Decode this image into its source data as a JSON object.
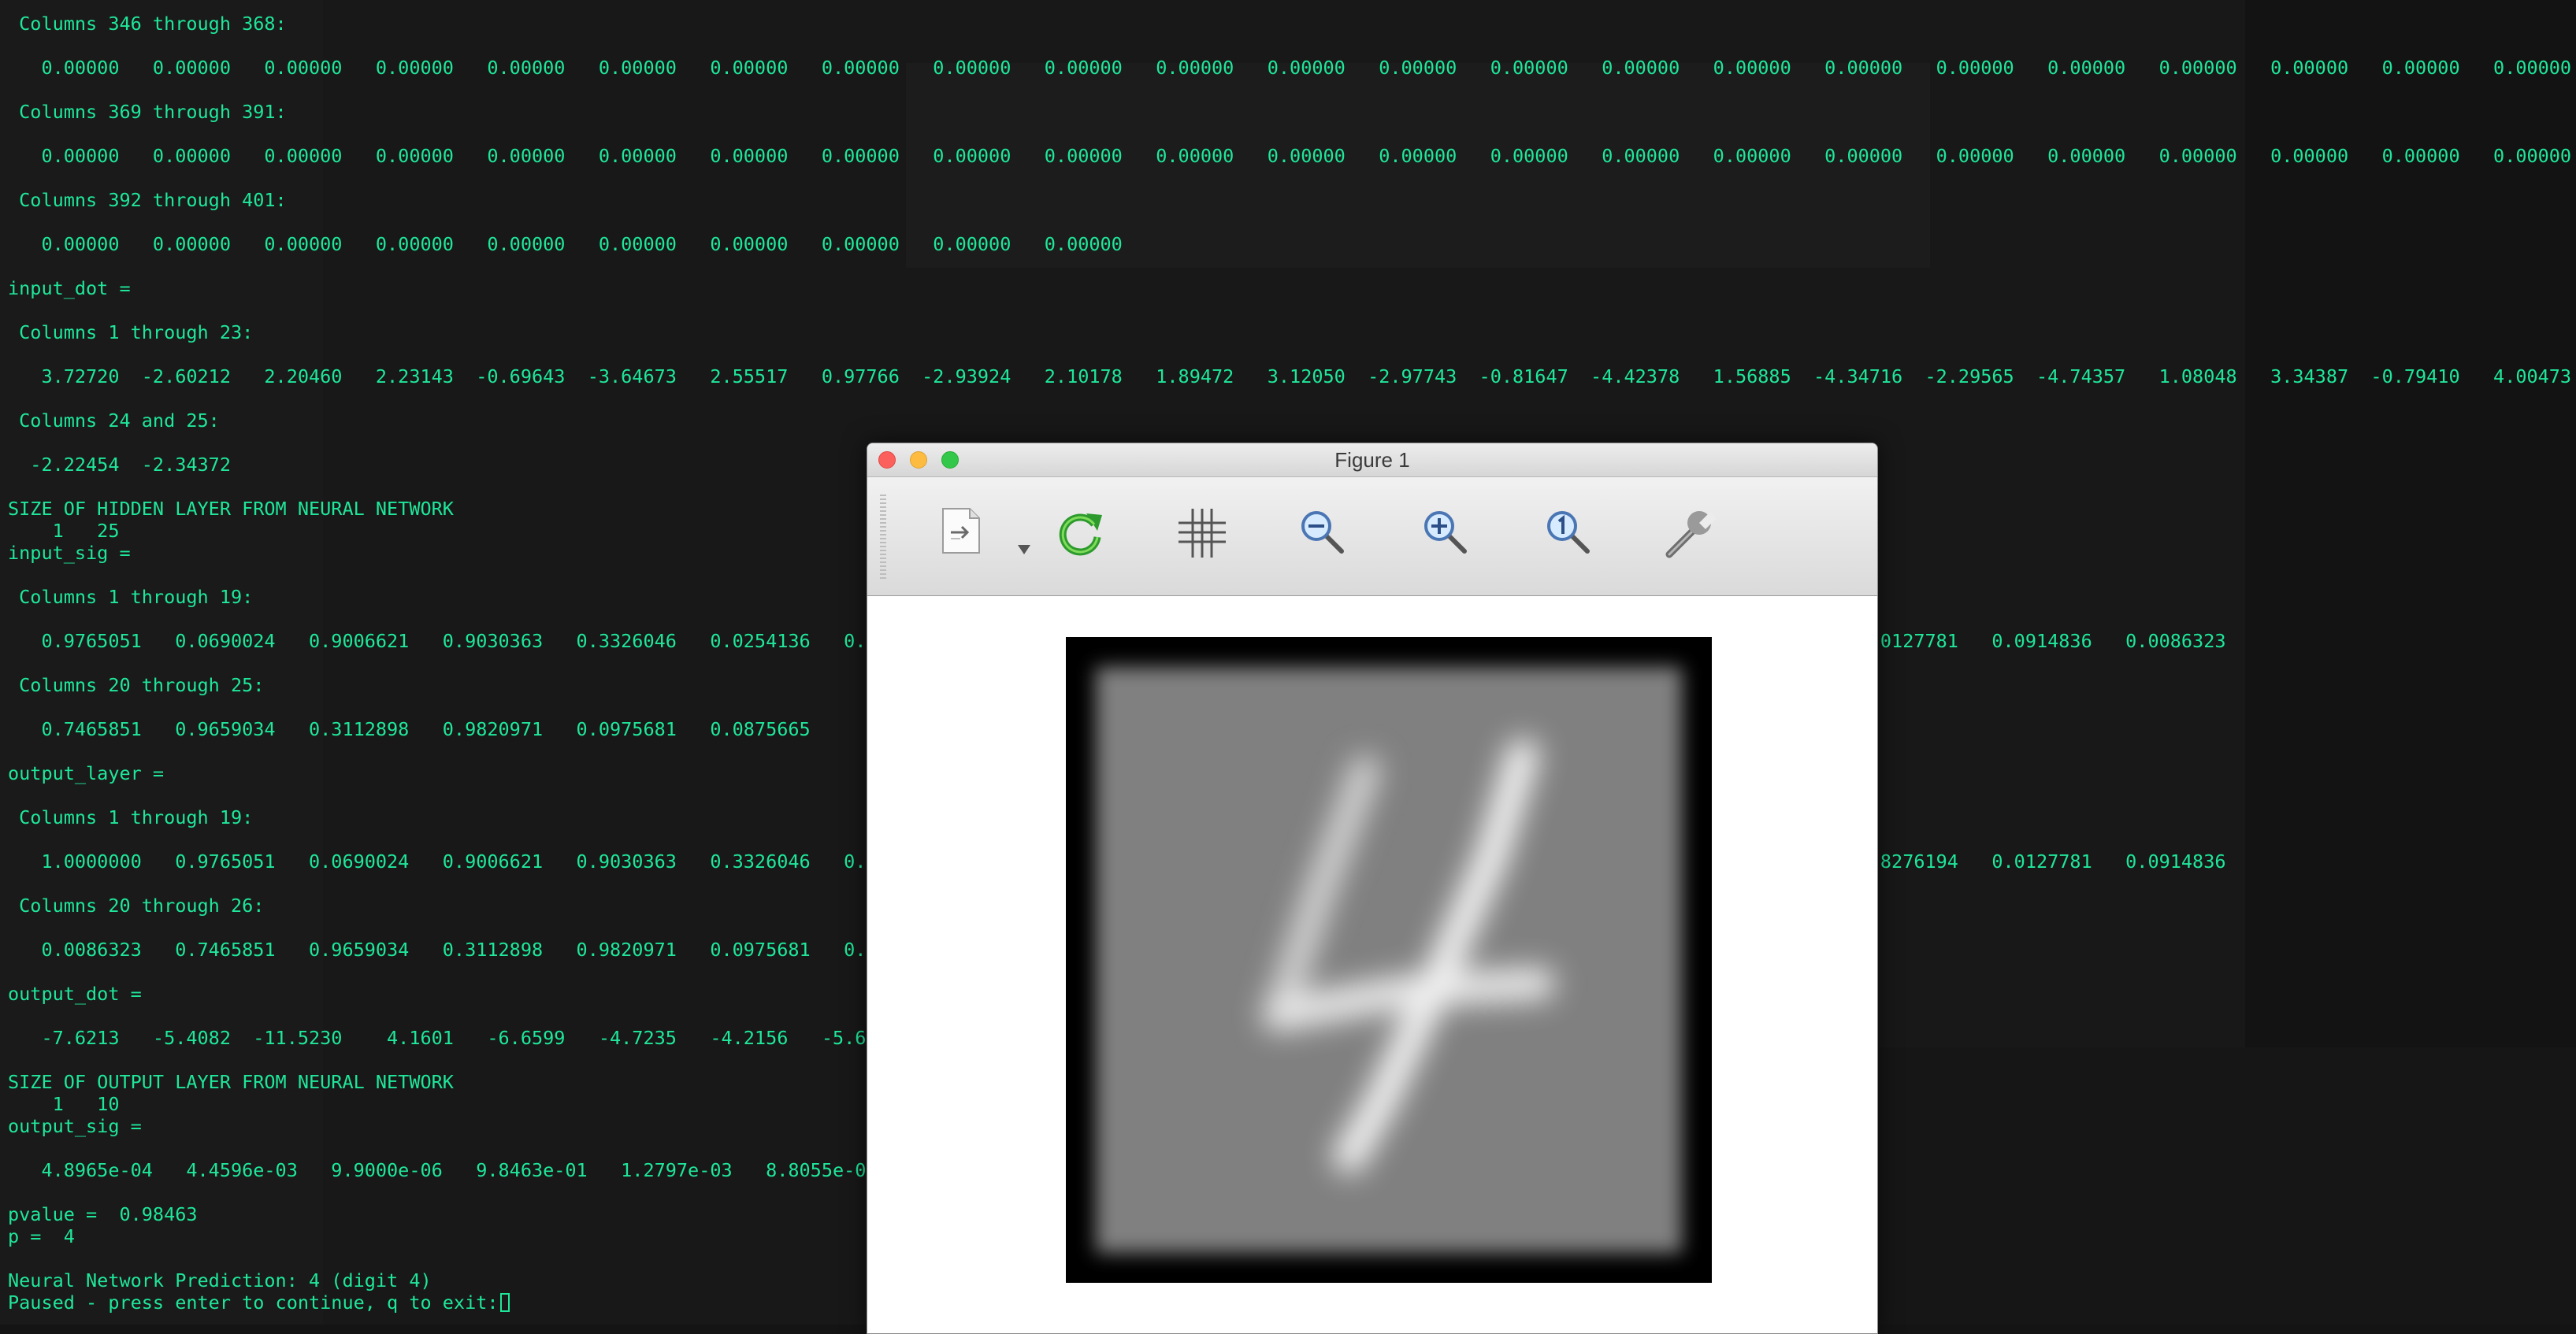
{
  "terminal": {
    "lines": [
      " Columns 346 through 368:",
      "",
      "   0.00000   0.00000   0.00000   0.00000   0.00000   0.00000   0.00000   0.00000   0.00000   0.00000   0.00000   0.00000   0.00000   0.00000   0.00000   0.00000   0.00000   0.00000   0.00000   0.00000   0.00000   0.00000   0.00000",
      "",
      " Columns 369 through 391:",
      "",
      "   0.00000   0.00000   0.00000   0.00000   0.00000   0.00000   0.00000   0.00000   0.00000   0.00000   0.00000   0.00000   0.00000   0.00000   0.00000   0.00000   0.00000   0.00000   0.00000   0.00000   0.00000   0.00000   0.00000",
      "",
      " Columns 392 through 401:",
      "",
      "   0.00000   0.00000   0.00000   0.00000   0.00000   0.00000   0.00000   0.00000   0.00000   0.00000",
      "",
      "input_dot =",
      "",
      " Columns 1 through 23:",
      "",
      "   3.72720  -2.60212   2.20460   2.23143  -0.69643  -3.64673   2.55517   0.97766  -2.93924   2.10178   1.89472   3.12050  -2.97743  -0.81647  -4.42378   1.56885  -4.34716  -2.29565  -4.74357   1.08048   3.34387  -0.79410   4.00473",
      "",
      " Columns 24 and 25:",
      "",
      "  -2.22454  -2.34372",
      "",
      "SIZE OF HIDDEN LAYER FROM NEURAL NETWORK",
      "    1   25",
      "input_sig =",
      "",
      " Columns 1 through 19:",
      "",
      "   0.9765051   0.0690024   0.9006621   0.9030363   0.3326046   0.0254136   0.9                                                                0.0118468   0.8276194   0.0127781   0.0914836   0.0086323",
      "",
      " Columns 20 through 25:",
      "",
      "   0.7465851   0.9659034   0.3112898   0.9820971   0.0975681   0.0875665",
      "",
      "output_layer =",
      "",
      " Columns 1 through 19:",
      "",
      "   1.0000000   0.9765051   0.0690024   0.9006621   0.9030363   0.3326046   0.0                                                                0.3065140   0.0118468   0.8276194   0.0127781   0.0914836",
      "",
      " Columns 20 through 26:",
      "",
      "   0.0086323   0.7465851   0.9659034   0.3112898   0.9820971   0.0975681   0.0",
      "",
      "output_dot =",
      "",
      "   -7.6213   -5.4082  -11.5230    4.1601   -6.6599   -4.7235   -4.2156   -5.60",
      "",
      "SIZE OF OUTPUT LAYER FROM NEURAL NETWORK",
      "    1   10",
      "output_sig =",
      "",
      "   4.8965e-04   4.4596e-03   9.9000e-06   9.8463e-01   1.2797e-03   8.8055e-03",
      "",
      "pvalue =  0.98463",
      "p =  4",
      "",
      "Neural Network Prediction: 4 (digit 4)",
      "Paused - press enter to continue, q to exit:"
    ]
  },
  "figure": {
    "title": "Figure 1",
    "toolbar": [
      {
        "name": "export-menu-icon",
        "label": "export"
      },
      {
        "name": "refresh-icon",
        "label": "refresh"
      },
      {
        "name": "grid-icon",
        "label": "grid"
      },
      {
        "name": "zoom-out-icon",
        "label": "zoom out"
      },
      {
        "name": "zoom-in-icon",
        "label": "zoom in"
      },
      {
        "name": "zoom-reset-icon",
        "label": "zoom 1:1"
      },
      {
        "name": "wrench-icon",
        "label": "settings"
      }
    ],
    "image_description_digit": "4"
  },
  "colors": {
    "terminal_text": "#1fe79a",
    "terminal_bg": "#141414",
    "window_chrome": "#ececec"
  }
}
